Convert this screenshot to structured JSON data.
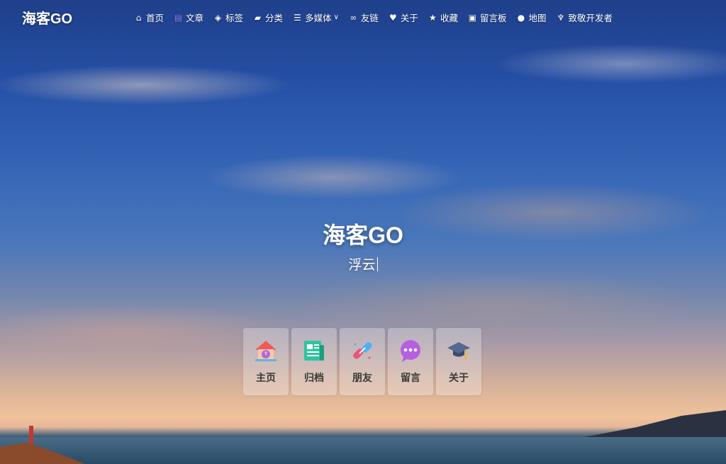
{
  "site": {
    "logo": "海客GO"
  },
  "nav": {
    "items": [
      {
        "label": "首页",
        "icon": "home-icon"
      },
      {
        "label": "文章",
        "icon": "archive-icon"
      },
      {
        "label": "标签",
        "icon": "tags-icon"
      },
      {
        "label": "分类",
        "icon": "folder-icon"
      },
      {
        "label": "多媒体",
        "icon": "list-icon"
      },
      {
        "label": "友链",
        "icon": "link-icon"
      },
      {
        "label": "关于",
        "icon": "heart-icon"
      },
      {
        "label": "收藏",
        "icon": "star-icon"
      },
      {
        "label": "留言板",
        "icon": "message-board-icon"
      },
      {
        "label": "地图",
        "icon": "map-pin-icon"
      },
      {
        "label": "致敬开发者",
        "icon": "tribute-icon"
      }
    ]
  },
  "hero": {
    "title": "海客GO",
    "subtitle": "浮云"
  },
  "cards": [
    {
      "label": "主页",
      "icon": "home-ribbon-icon"
    },
    {
      "label": "归档",
      "icon": "news-archive-icon"
    },
    {
      "label": "朋友",
      "icon": "link-chain-icon"
    },
    {
      "label": "留言",
      "icon": "chat-bubble-icon"
    },
    {
      "label": "关于",
      "icon": "graduation-cap-icon"
    }
  ],
  "colors": {
    "archive_icon": "#6d5bd0",
    "text_white": "#ffffff"
  }
}
